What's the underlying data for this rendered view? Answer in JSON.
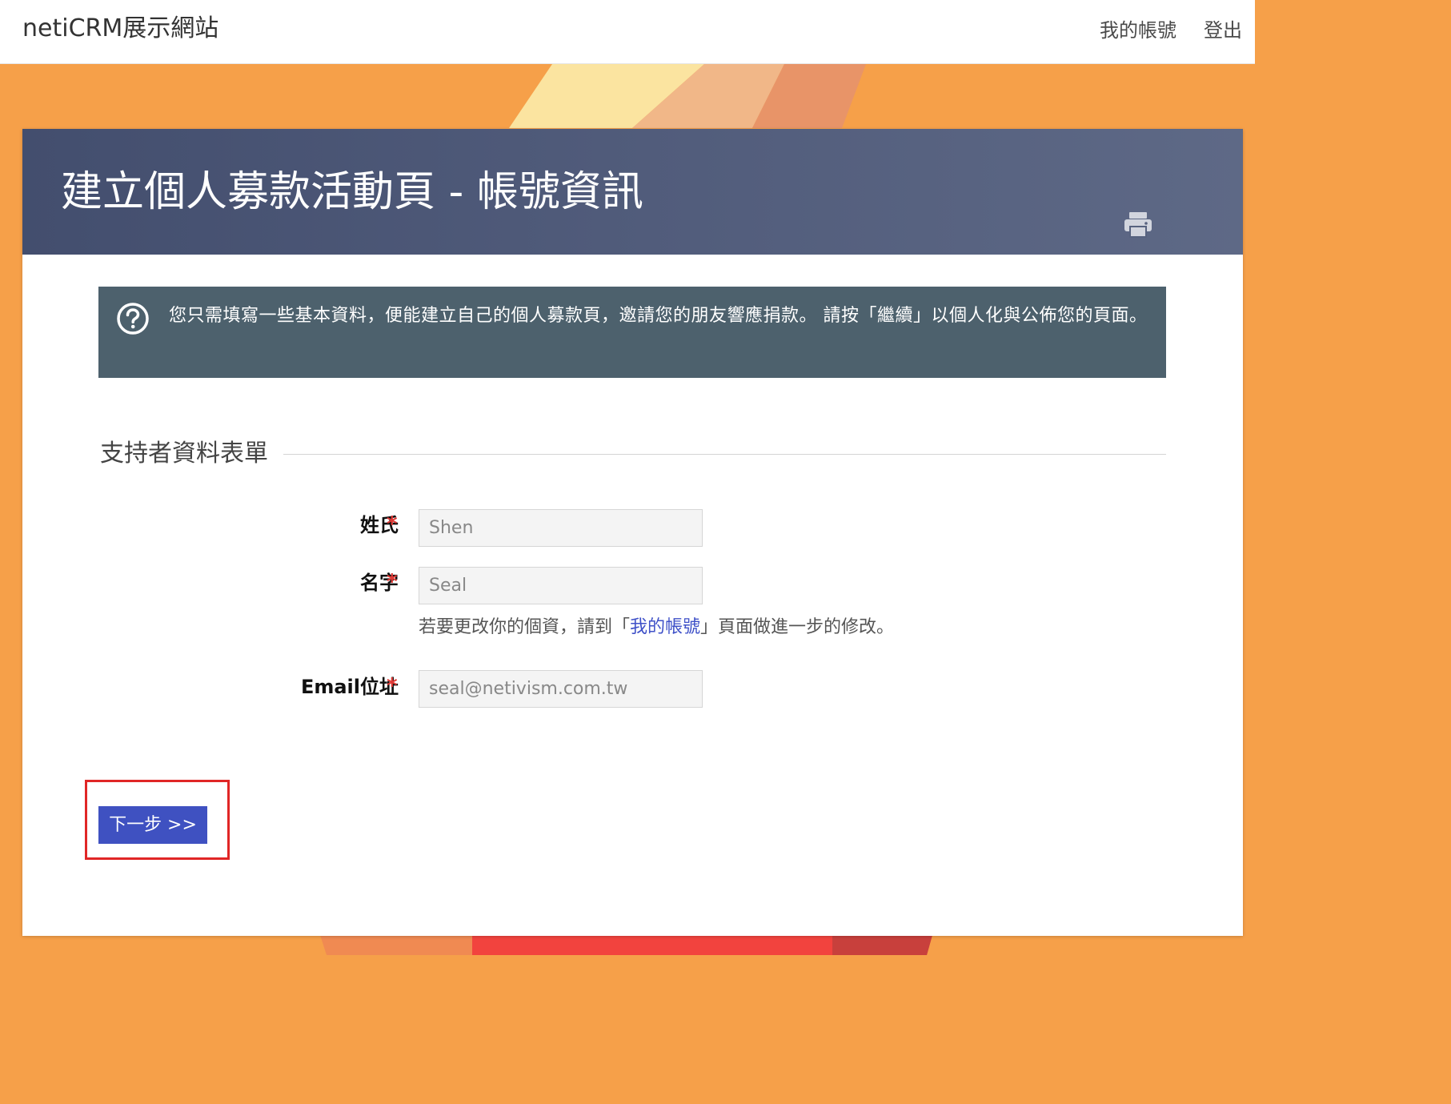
{
  "site": {
    "name": "netiCRM展示網站"
  },
  "nav": {
    "items": [
      {
        "label": "我的帳號"
      },
      {
        "label": "登出"
      }
    ]
  },
  "page": {
    "title": "建立個人募款活動頁 - 帳號資訊",
    "print_icon": "print-icon"
  },
  "info": {
    "icon": "help-circle-icon",
    "text": "您只需填寫一些基本資料，便能建立自己的個人募款頁，邀請您的朋友響應捐款。 請按「繼續」以個人化與公佈您的頁面。"
  },
  "form": {
    "section_title": "支持者資料表單",
    "required_marker": "*",
    "fields": [
      {
        "label": "姓氏",
        "value": "Shen"
      },
      {
        "label": "名字",
        "value": "Seal"
      },
      {
        "label": "Email位址",
        "value": "seal@netivism.com.tw"
      }
    ],
    "help": {
      "prefix": "若要更改你的個資，請到「",
      "link": "我的帳號",
      "suffix": "」頁面做進一步的修改。"
    },
    "next_button": "下一步 >>"
  },
  "colors": {
    "background": "#f6a049",
    "header": "#4b5675",
    "info_box": "#4d616d",
    "button": "#3f51c1",
    "required": "#e03a36",
    "link": "#3f51c8",
    "highlight": "#e02626"
  }
}
